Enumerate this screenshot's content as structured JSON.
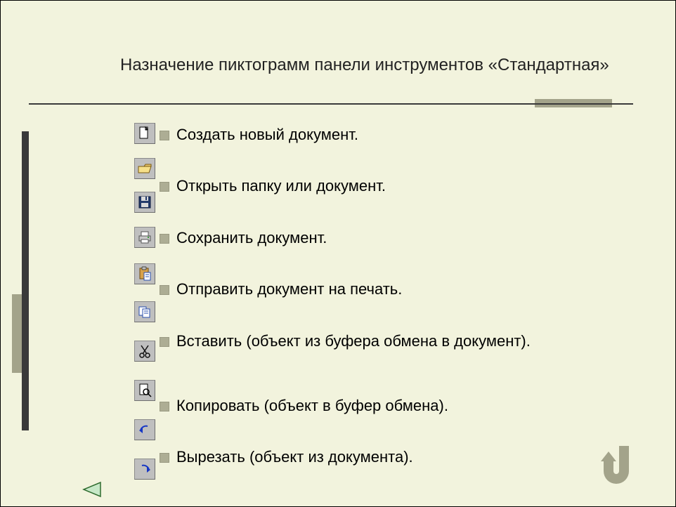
{
  "title": "Назначение пиктограмм панели инструментов «Стандартная»",
  "icons": {
    "new": "new-document-icon",
    "open": "open-folder-icon",
    "save": "save-floppy-icon",
    "print": "printer-icon",
    "paste": "paste-clipboard-icon",
    "copy": "copy-pages-icon",
    "cut": "cut-scissors-icon",
    "preview": "print-preview-icon",
    "undo": "undo-icon",
    "redo": "redo-icon"
  },
  "items": [
    {
      "label": "Создать новый документ."
    },
    {
      "label": "Открыть папку или документ."
    },
    {
      "label": "Сохранить документ."
    },
    {
      "label": "Отправить документ на печать."
    },
    {
      "label": "Вставить (объект из буфера обмена в документ)."
    },
    {
      "label": "Копировать (объект в буфер обмена)."
    },
    {
      "label": "Вырезать (объект из документа)."
    }
  ],
  "nav": {
    "prev": "previous-slide",
    "back": "back-to-start"
  }
}
